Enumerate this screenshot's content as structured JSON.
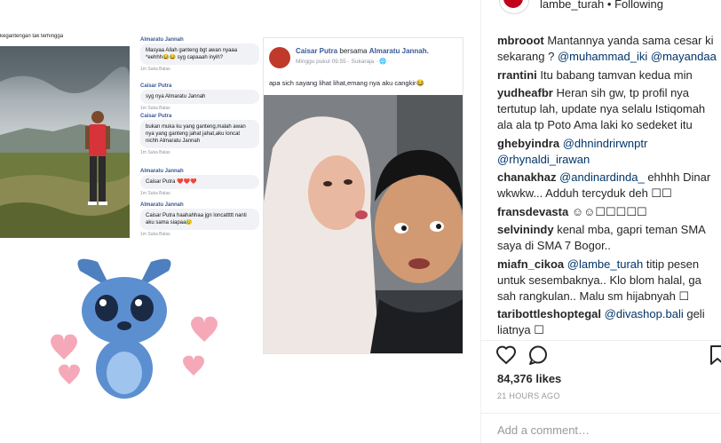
{
  "post_image": {
    "left_caption": "kegantengan tak terhingga",
    "chat": [
      {
        "who": "Almaratu Jannah",
        "text": "Masyaa Allah ganteng bgt awan nyaaa *eehhh😂😂 syg capaaah inyih?",
        "acts": "1m   Suka   Balas"
      },
      {
        "who": "Caisar Putra",
        "text": "syg nya Almaratu Jannah",
        "acts": "1m   Suka   Balas"
      },
      {
        "who": "Caisar Putra",
        "text": "bukan muka ku yang ganteng,malah awan nya yang ganteng jahat jahat,aku loncat nichh Almaratu Jannah",
        "acts": "1m   Suka   Balas"
      },
      {
        "who": "Almaratu Jannah",
        "text": "Caisar Putra ❤️❤️❤️",
        "acts": "1m   Suka   Balas"
      },
      {
        "who": "Almaratu Jannah",
        "text": "Caisar Putra haahahhaa jgn loncattttt nanti aku sama siapaa😥",
        "acts": "1m   Suka   Balas"
      }
    ],
    "fb_post": {
      "author": "Caisar Putra",
      "with_word": "bersama",
      "with_name": "Almaratu Jannah.",
      "meta": "Minggu pukul 09.55 · Sukaraja · 🌐",
      "text": "apa sich sayang lihat lihat,emang nya aku cangkir😂"
    }
  },
  "header": {
    "username": "lambe_turah",
    "separator": " • ",
    "status": "Following"
  },
  "comments": [
    {
      "user": "mbrooot",
      "segments": [
        {
          "t": " Mantannya yanda sama cesar ki sekarang ? "
        },
        {
          "t": "@muhammad_iki",
          "m": true
        },
        {
          "t": " "
        },
        {
          "t": "@mayandaa",
          "m": true
        }
      ]
    },
    {
      "user": "rrantini",
      "segments": [
        {
          "t": " Itu babang tamvan kedua min"
        }
      ]
    },
    {
      "user": "yudheafbr",
      "segments": [
        {
          "t": " Heran sih gw, tp profil nya tertutup lah, update nya selalu Istiqomah ala ala tp Poto Ama laki ko sedeket itu"
        }
      ]
    },
    {
      "user": "ghebyindra",
      "segments": [
        {
          "t": " "
        },
        {
          "t": "@dhnindrirwnptr",
          "m": true
        },
        {
          "t": " "
        },
        {
          "t": "@rhynaldi_irawan",
          "m": true
        }
      ]
    },
    {
      "user": "chanakhaz",
      "segments": [
        {
          "t": " "
        },
        {
          "t": "@andinardinda_",
          "m": true
        },
        {
          "t": " ehhhh Dinar wkwkw... Adduh tercyduk deh ☐☐"
        }
      ]
    },
    {
      "user": "fransdevasta",
      "segments": [
        {
          "t": " ☺☺☐☐☐☐☐"
        }
      ]
    },
    {
      "user": "selvinindy",
      "segments": [
        {
          "t": " kenal mba, gapri teman SMA saya di SMA 7 Bogor.."
        }
      ]
    },
    {
      "user": "miafn_cikoa",
      "segments": [
        {
          "t": " "
        },
        {
          "t": "@lambe_turah",
          "m": true
        },
        {
          "t": " titip pesen untuk sesembaknya.. Klo blom halal, ga sah rangkulan.. Malu sm hijabnyah ☐"
        }
      ]
    },
    {
      "user": "taribottleshoptegal",
      "segments": [
        {
          "t": " "
        },
        {
          "t": "@divashop.bali",
          "m": true
        },
        {
          "t": " geli liatnya ☐"
        }
      ]
    }
  ],
  "actions": {
    "like_icon": "heart-icon",
    "comment_icon": "comment-icon",
    "save_icon": "bookmark-icon"
  },
  "likes": "84,376 likes",
  "timestamp": "21 HOURS AGO",
  "add_comment_placeholder": "Add a comment…"
}
